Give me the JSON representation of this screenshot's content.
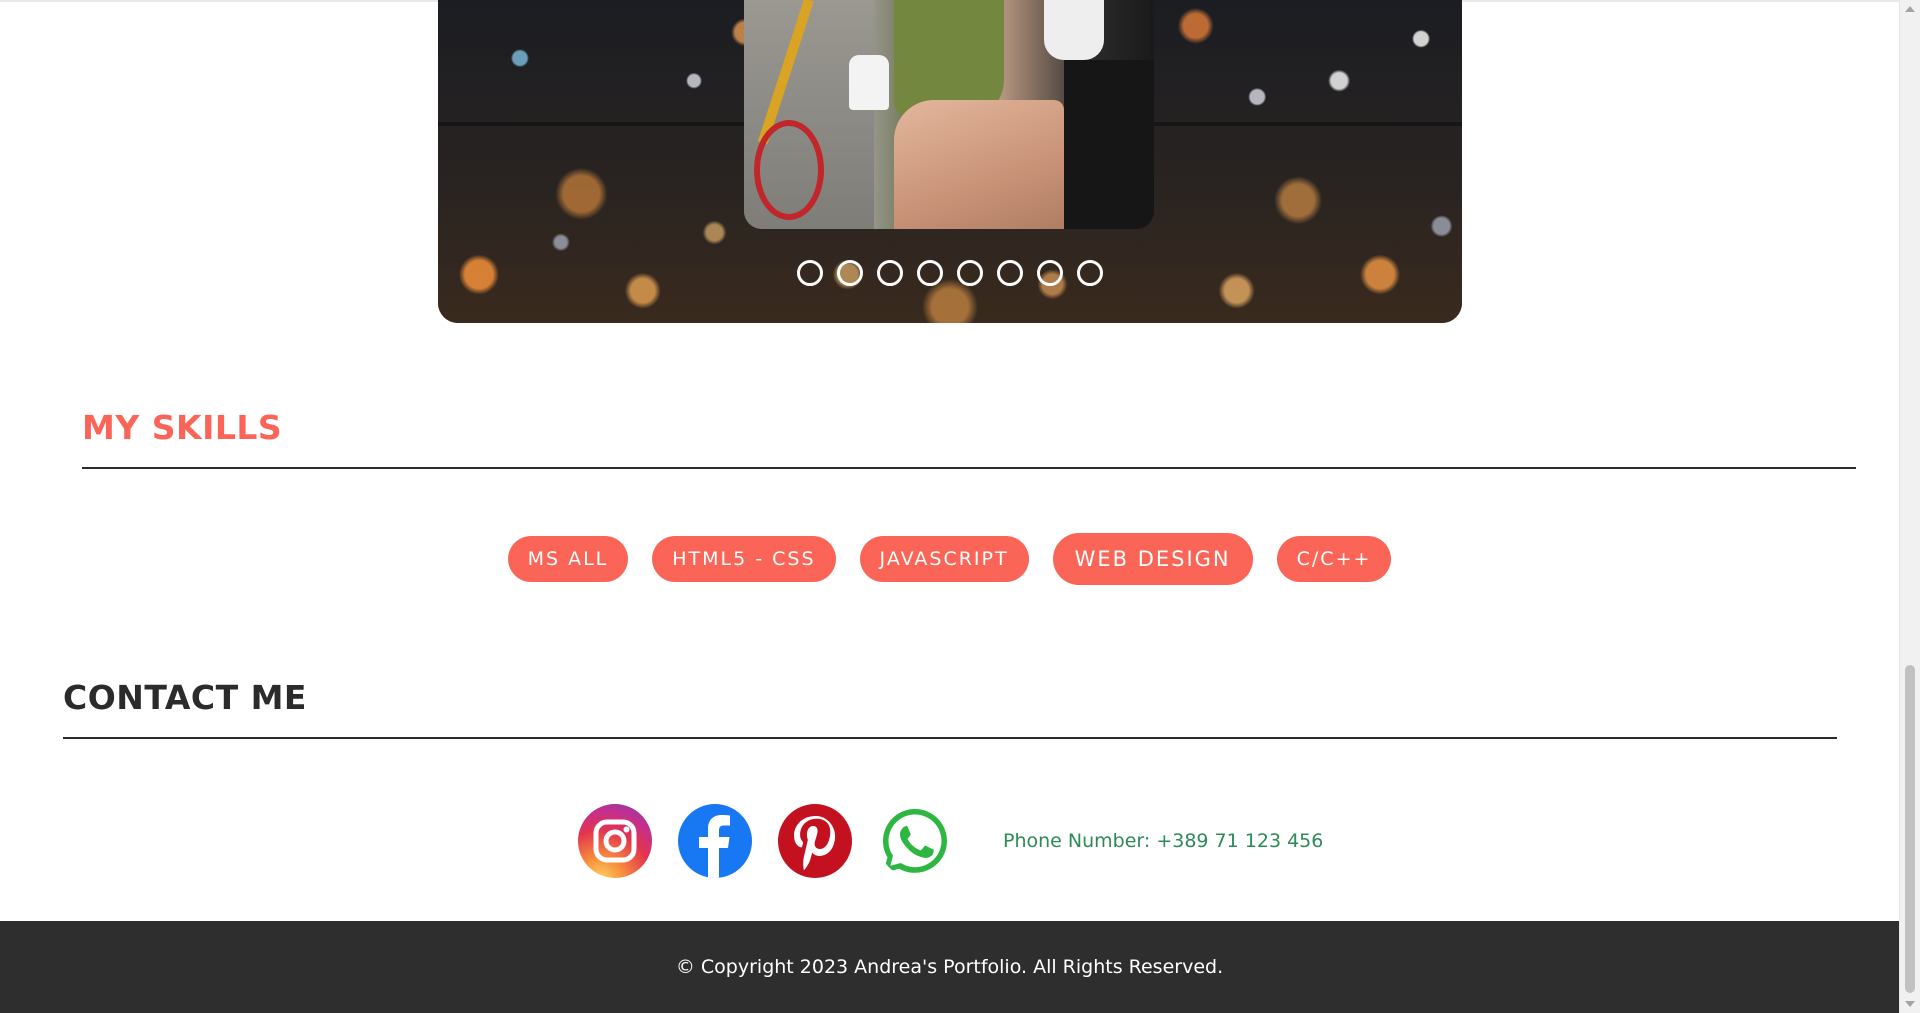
{
  "carousel": {
    "slide_count": 8,
    "dots": [
      {
        "label": ""
      },
      {
        "label": ""
      },
      {
        "label": ""
      },
      {
        "label": ""
      },
      {
        "label": ""
      },
      {
        "label": ""
      },
      {
        "label": ""
      },
      {
        "label": ""
      }
    ]
  },
  "skills": {
    "title": "MY SKILLS",
    "items": [
      "MS ALL",
      "HTML5 - CSS",
      "JAVASCRIPT",
      "WEB DESIGN",
      "C/C++"
    ],
    "accent_color": "#fa6558"
  },
  "contact": {
    "title": "CONTACT ME",
    "social": [
      {
        "name": "instagram-icon"
      },
      {
        "name": "facebook-icon"
      },
      {
        "name": "pinterest-icon"
      },
      {
        "name": "whatsapp-icon"
      }
    ],
    "phone": "Phone Number: +389 71 123 456",
    "phone_color": "#2e8b57"
  },
  "footer": {
    "copyright": "© Copyright 2023 Andrea's Portfolio. All Rights Reserved.",
    "background": "#2e2e2e"
  }
}
